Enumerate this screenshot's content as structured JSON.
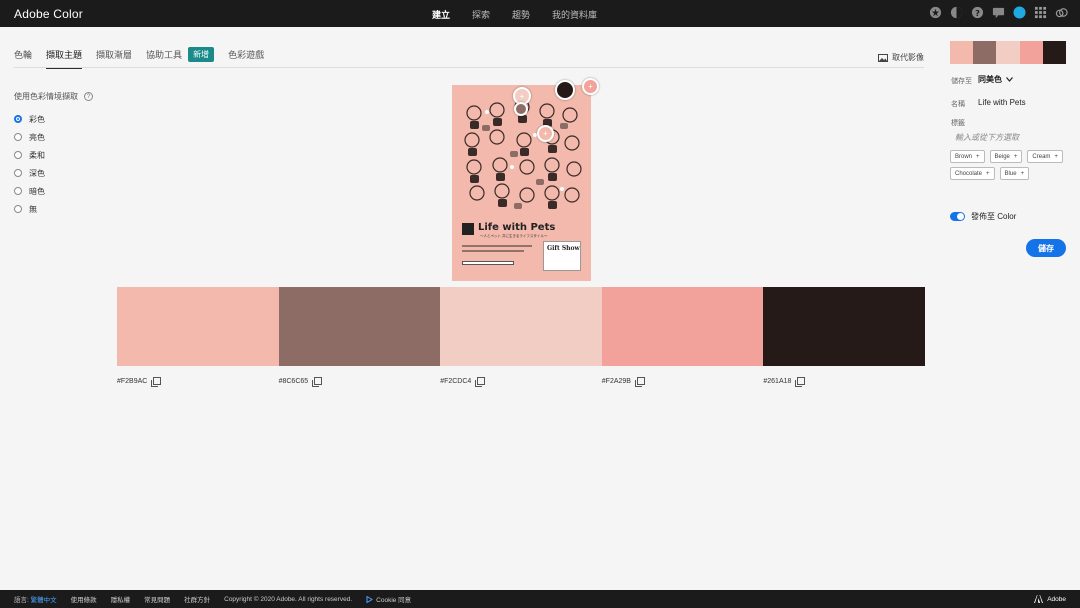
{
  "app": {
    "title": "Adobe Color"
  },
  "topnav": [
    {
      "label": "建立",
      "active": true
    },
    {
      "label": "探索",
      "active": false
    },
    {
      "label": "趨勢",
      "active": false
    },
    {
      "label": "我的資料庫",
      "active": false
    }
  ],
  "tabs": [
    {
      "label": "色輪"
    },
    {
      "label": "擷取主題"
    },
    {
      "label": "擷取漸層"
    },
    {
      "label": "協助工具"
    },
    {
      "label": "色彩遊戲"
    }
  ],
  "badge": {
    "label": "新增"
  },
  "replace_image": {
    "label": "取代影像"
  },
  "mood": {
    "title": "使用色彩情境擷取",
    "options": [
      "彩色",
      "亮色",
      "柔和",
      "深色",
      "暗色",
      "無"
    ],
    "selected": "彩色"
  },
  "poster": {
    "title": "Life with Pets",
    "subtitle": "〜人とペット 共に生きるライフスタイル〜",
    "gift": "Gift Show"
  },
  "palette": [
    {
      "hex": "#F2B9AC",
      "color": "#f2b9ac"
    },
    {
      "hex": "#8C6C65",
      "color": "#8c6c65"
    },
    {
      "hex": "#F2CDC4",
      "color": "#f2cdc4"
    },
    {
      "hex": "#F2A29B",
      "color": "#f2a29b"
    },
    {
      "hex": "#261A18",
      "color": "#261a18"
    }
  ],
  "right_panel": {
    "save_to_label": "儲存至",
    "library": "同美色",
    "name_label": "名稱",
    "name_value": "Life with Pets",
    "tags_label": "標籤",
    "tags_placeholder": "輸入或從下方選取",
    "tags": [
      "Brown",
      "Beige",
      "Cream",
      "Chocolate",
      "Blue"
    ],
    "publish_label": "發佈至 Color",
    "save_label": "儲存"
  },
  "footer": {
    "language_label": "語言:",
    "language_value": "繁體中文",
    "terms": "使用條款",
    "privacy": "隱私權",
    "faq": "常見問題",
    "community": "社群方針",
    "copyright": "Copyright © 2020 Adobe. All rights reserved.",
    "cookie": "Cookie 同意",
    "adobe": "Adobe"
  }
}
